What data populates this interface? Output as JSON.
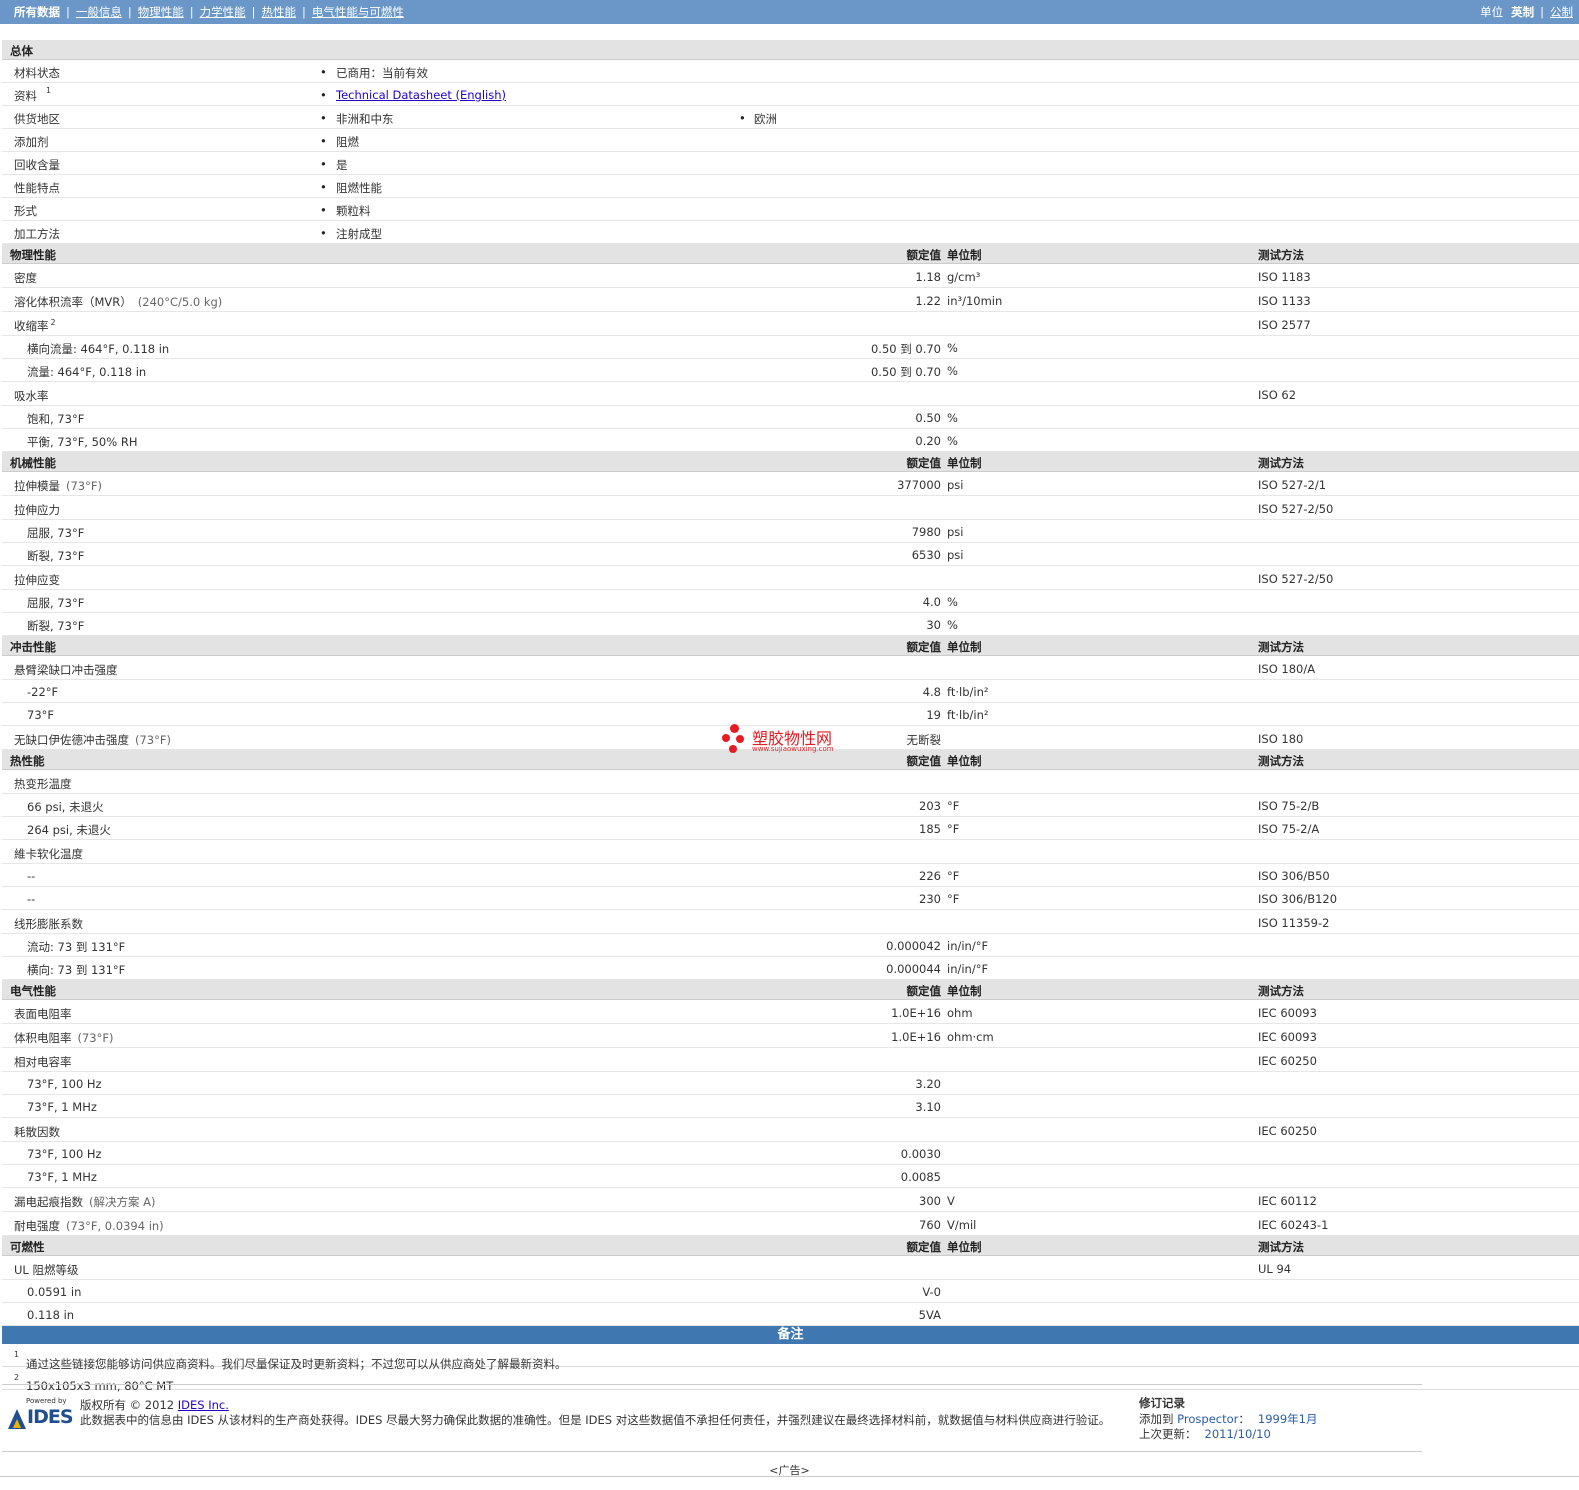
{
  "nav": {
    "all": "所有数据",
    "links": [
      "一般信息",
      "物理性能",
      "力学性能",
      "热性能",
      "电气性能与可燃性"
    ],
    "units_label": "单位",
    "unit_imperial": "英制",
    "unit_metric": "公制"
  },
  "headers": {
    "nominal": "额定值",
    "unit": "单位制",
    "test": "测试方法"
  },
  "general": {
    "title": "总体",
    "rows": [
      {
        "label": "材料状态",
        "values": [
          "已商用：当前有效"
        ]
      },
      {
        "label": "资料",
        "sup": "1",
        "link": "Technical Datasheet (English)"
      },
      {
        "label": "供货地区",
        "values": [
          "非洲和中东",
          "欧洲"
        ]
      },
      {
        "label": "添加剂",
        "values": [
          "阻燃"
        ]
      },
      {
        "label": "回收含量",
        "values": [
          "是"
        ]
      },
      {
        "label": "性能特点",
        "values": [
          "阻燃性能"
        ]
      },
      {
        "label": "形式",
        "values": [
          "颗粒料"
        ]
      },
      {
        "label": "加工方法",
        "values": [
          "注射成型"
        ]
      }
    ]
  },
  "physical": {
    "title": "物理性能",
    "rows": [
      {
        "label": "密度",
        "value": "1.18",
        "unit": "g/cm³",
        "test": "ISO 1183"
      },
      {
        "label": "溶化体积流率（MVR）",
        "note": "(240°C/5.0 kg)",
        "value": "1.22",
        "unit": "in³/10min",
        "test": "ISO 1133"
      },
      {
        "label": "收缩率",
        "sup": "2",
        "test": "ISO 2577"
      },
      {
        "label": "横向流量: 464°F, 0.118 in",
        "sub": true,
        "value": "0.50 到  0.70",
        "unit": "%"
      },
      {
        "label": "流量: 464°F, 0.118 in",
        "sub": true,
        "value": "0.50 到  0.70",
        "unit": "%"
      },
      {
        "label": "吸水率",
        "test": "ISO 62"
      },
      {
        "label": "饱和, 73°F",
        "sub": true,
        "value": "0.50",
        "unit": "%"
      },
      {
        "label": "平衡, 73°F, 50% RH",
        "sub": true,
        "value": "0.20",
        "unit": "%"
      }
    ]
  },
  "mechanical": {
    "title": "机械性能",
    "rows": [
      {
        "label": "拉伸模量",
        "note": "(73°F)",
        "value": "377000",
        "unit": "psi",
        "test": "ISO 527-2/1"
      },
      {
        "label": "拉伸应力",
        "test": "ISO 527-2/50"
      },
      {
        "label": "屈服, 73°F",
        "sub": true,
        "value": "7980",
        "unit": "psi"
      },
      {
        "label": "断裂, 73°F",
        "sub": true,
        "value": "6530",
        "unit": "psi"
      },
      {
        "label": "拉伸应变",
        "test": "ISO 527-2/50"
      },
      {
        "label": "屈服, 73°F",
        "sub": true,
        "value": "4.0",
        "unit": "%"
      },
      {
        "label": "断裂, 73°F",
        "sub": true,
        "value": "30",
        "unit": "%"
      }
    ]
  },
  "impact": {
    "title": "冲击性能",
    "rows": [
      {
        "label": "悬臂梁缺口冲击强度",
        "test": "ISO 180/A"
      },
      {
        "label": "-22°F",
        "sub": true,
        "value": "4.8",
        "unit": "ft·lb/in²"
      },
      {
        "label": "73°F",
        "sub": true,
        "value": "19",
        "unit": "ft·lb/in²"
      },
      {
        "label": "无缺口伊佐德冲击强度",
        "note": "(73°F)",
        "value": "无断裂",
        "test": "ISO 180"
      }
    ]
  },
  "thermal": {
    "title": "热性能",
    "rows": [
      {
        "label": "热变形温度"
      },
      {
        "label": "66 psi, 未退火",
        "sub": true,
        "value": "203",
        "unit": "°F",
        "test": "ISO 75-2/B"
      },
      {
        "label": "264 psi, 未退火",
        "sub": true,
        "value": "185",
        "unit": "°F",
        "test": "ISO 75-2/A"
      },
      {
        "label": "維卡软化温度"
      },
      {
        "label": "--",
        "sub": true,
        "value": "226",
        "unit": "°F",
        "test": "ISO 306/B50"
      },
      {
        "label": "--",
        "sub": true,
        "value": "230",
        "unit": "°F",
        "test": "ISO 306/B120"
      },
      {
        "label": "线形膨胀系数",
        "test": "ISO 11359-2"
      },
      {
        "label": "流动: 73 到  131°F",
        "sub": true,
        "value": "0.000042",
        "unit": "in/in/°F"
      },
      {
        "label": "横向: 73 到  131°F",
        "sub": true,
        "value": "0.000044",
        "unit": "in/in/°F"
      }
    ]
  },
  "electrical": {
    "title": "电气性能",
    "rows": [
      {
        "label": "表面电阻率",
        "value": "1.0E+16",
        "unit": "ohm",
        "test": "IEC 60093"
      },
      {
        "label": "体积电阻率",
        "note": "(73°F)",
        "value": "1.0E+16",
        "unit": "ohm·cm",
        "test": "IEC 60093"
      },
      {
        "label": "相对电容率",
        "test": "IEC 60250"
      },
      {
        "label": "73°F, 100 Hz",
        "sub": true,
        "value": "3.20"
      },
      {
        "label": "73°F, 1 MHz",
        "sub": true,
        "value": "3.10"
      },
      {
        "label": "耗散因数",
        "test": "IEC 60250"
      },
      {
        "label": "73°F, 100 Hz",
        "sub": true,
        "value": "0.0030"
      },
      {
        "label": "73°F, 1 MHz",
        "sub": true,
        "value": "0.0085"
      },
      {
        "label": "漏电起痕指数",
        "note": "(解决方案  A)",
        "value": "300",
        "unit": "V",
        "test": "IEC 60112"
      },
      {
        "label": "耐电强度",
        "note": "(73°F, 0.0394 in)",
        "value": "760",
        "unit": "V/mil",
        "test": "IEC 60243-1"
      }
    ]
  },
  "flammability": {
    "title": "可燃性",
    "rows": [
      {
        "label": "UL 阻燃等级",
        "test": "UL 94"
      },
      {
        "label": "0.0591 in",
        "sub": true,
        "value": "V-0"
      },
      {
        "label": "0.118 in",
        "sub": true,
        "value": "5VA"
      }
    ]
  },
  "notes": {
    "title": "备注",
    "items": [
      {
        "sup": "1",
        "text": "通过这些链接您能够访问供应商资料。我们尽量保证及时更新资料；不过您可以从供应商处了解最新资料。"
      },
      {
        "sup": "2",
        "text": "150x105x3 mm, 80°C MT"
      }
    ]
  },
  "footer": {
    "powered_by": "Powered by",
    "logo_text": "IDES",
    "copyright": "版权所有  © 2012 ",
    "company_link": "IDES Inc.",
    "disclaimer": "此数据表中的信息由 IDES 从该材料的生产商处获得。IDES 尽最大努力确保此数据的准确性。但是 IDES 对这些数据值不承担任何责任，并强烈建议在最终选择材料前，就数据值与材料供应商进行验证。",
    "revision_title": "修订记录",
    "added_label": "添加到 ",
    "added_app": "Prospector",
    "added_sep": "：",
    "added_date": "1999年1月",
    "updated_label": "上次更新：",
    "updated_date": "2011/10/10",
    "ad": "<广告>"
  },
  "watermark": {
    "text": "塑胶物性网",
    "url": "www.sujiaowuxing.com"
  }
}
